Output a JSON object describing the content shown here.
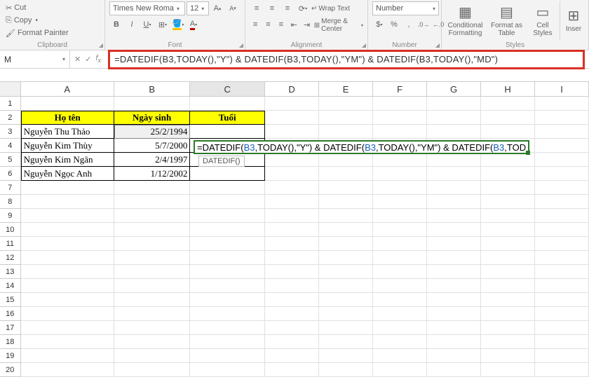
{
  "ribbon": {
    "clipboard": {
      "cut": "Cut",
      "copy": "Copy",
      "format_painter": "Format Painter",
      "label": "Clipboard"
    },
    "font": {
      "name": "Times New Roma",
      "size": "12",
      "label": "Font"
    },
    "alignment": {
      "wrap": "Wrap Text",
      "merge": "Merge & Center",
      "label": "Alignment"
    },
    "number": {
      "format": "Number",
      "label": "Number"
    },
    "styles": {
      "cond": "Conditional\nFormatting",
      "table": "Format as\nTable",
      "cell": "Cell\nStyles",
      "insert": "Inser",
      "label": "Styles"
    }
  },
  "namebox": "M",
  "formula": "=DATEDIF(B3,TODAY(),\"Y\") & DATEDIF(B3,TODAY(),\"YM\") & DATEDIF(B3,TODAY(),\"MD\")",
  "formula_parts": {
    "p1": "=DATEDIF(",
    "r1": "B3",
    "p2": ",TODAY(),\"Y\") & DATEDIF(",
    "r2": "B3",
    "p3": ",TODAY(),\"YM\") & DATEDIF(",
    "r3": "B3",
    "p4": ",TOD"
  },
  "tooltip": "DATEDIF()",
  "cols": [
    "A",
    "B",
    "C",
    "D",
    "E",
    "F",
    "G",
    "H",
    "I"
  ],
  "headers": {
    "A": "Họ tên",
    "B": "Ngày sinh",
    "C": "Tuổi"
  },
  "data": [
    {
      "name": "Nguyễn Thu Thảo",
      "dob": "25/2/1994"
    },
    {
      "name": "Nguyễn Kim Thùy",
      "dob": "5/7/2000"
    },
    {
      "name": "Nguyễn Kim Ngân",
      "dob": "2/4/1997"
    },
    {
      "name": "Nguyễn Ngọc Anh",
      "dob": "1/12/2002"
    }
  ]
}
